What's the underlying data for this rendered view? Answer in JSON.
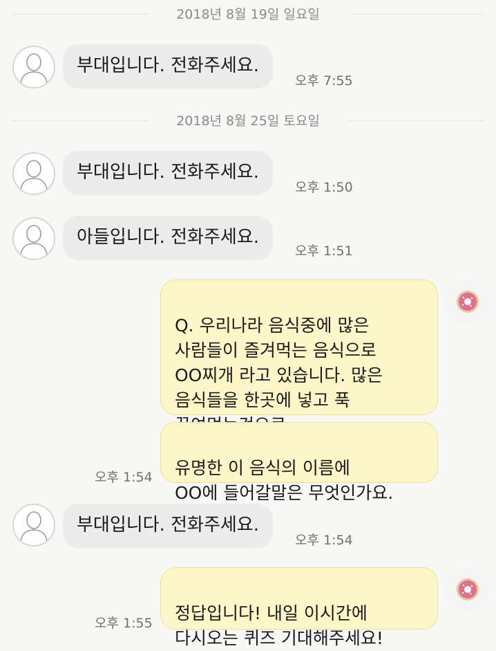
{
  "dates": {
    "d1": "2018년 8월 19일 일요일",
    "d2": "2018년 8월 25일 토요일"
  },
  "messages": [
    {
      "side": "in",
      "text": "부대입니다. 전화주세요.",
      "time": "오후 7:55"
    },
    {
      "side": "in",
      "text": "부대입니다. 전화주세요.",
      "time": "오후 1:50"
    },
    {
      "side": "in",
      "text": "아들입니다. 전화주세요.",
      "time": "오후 1:51"
    },
    {
      "side": "out",
      "text": "Q. 우리나라 음식중에 많은\n사람들이 즐겨먹는 음식으로\nOO찌개 라고 있습니다. 많은\n음식들을 한곳에 넣고 푹\n끓여먹는것으로",
      "time": ""
    },
    {
      "side": "out",
      "text": "유명한 이 음식의 이름에\nOO에 들어갈말은 무엇인가요.",
      "time": "오후 1:54"
    },
    {
      "side": "in",
      "text": "부대입니다. 전화주세요.",
      "time": "오후 1:54"
    },
    {
      "side": "out",
      "text": "정답입니다! 내일 이시간에\n다시오는 퀴즈 기대해주세요!",
      "time": "오후 1:55"
    }
  ],
  "icons": {
    "contact_avatar": "person-outline-icon",
    "self_avatar": "donut-icon"
  },
  "colors": {
    "incoming_bubble": "#ececec",
    "outgoing_bubble": "#fdf6c9",
    "background": "#f7f7f5",
    "donut_frosting": "#e07090"
  }
}
